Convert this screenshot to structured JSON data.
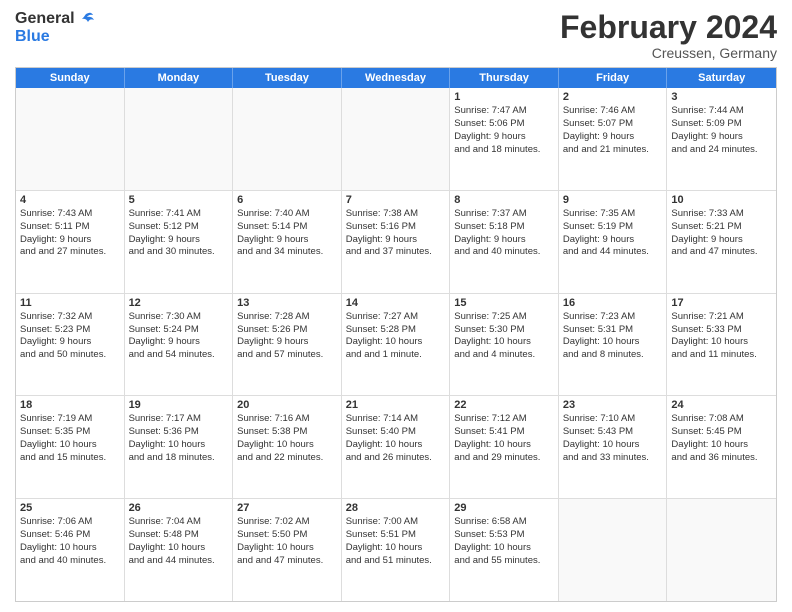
{
  "header": {
    "logo_line1": "General",
    "logo_line2": "Blue",
    "main_title": "February 2024",
    "subtitle": "Creussen, Germany"
  },
  "days_of_week": [
    "Sunday",
    "Monday",
    "Tuesday",
    "Wednesday",
    "Thursday",
    "Friday",
    "Saturday"
  ],
  "weeks": [
    [
      {
        "day": "",
        "empty": true
      },
      {
        "day": "",
        "empty": true
      },
      {
        "day": "",
        "empty": true
      },
      {
        "day": "",
        "empty": true
      },
      {
        "day": "1",
        "sunrise": "Sunrise: 7:47 AM",
        "sunset": "Sunset: 5:06 PM",
        "daylight": "Daylight: 9 hours and 18 minutes."
      },
      {
        "day": "2",
        "sunrise": "Sunrise: 7:46 AM",
        "sunset": "Sunset: 5:07 PM",
        "daylight": "Daylight: 9 hours and 21 minutes."
      },
      {
        "day": "3",
        "sunrise": "Sunrise: 7:44 AM",
        "sunset": "Sunset: 5:09 PM",
        "daylight": "Daylight: 9 hours and 24 minutes."
      }
    ],
    [
      {
        "day": "4",
        "sunrise": "Sunrise: 7:43 AM",
        "sunset": "Sunset: 5:11 PM",
        "daylight": "Daylight: 9 hours and 27 minutes."
      },
      {
        "day": "5",
        "sunrise": "Sunrise: 7:41 AM",
        "sunset": "Sunset: 5:12 PM",
        "daylight": "Daylight: 9 hours and 30 minutes."
      },
      {
        "day": "6",
        "sunrise": "Sunrise: 7:40 AM",
        "sunset": "Sunset: 5:14 PM",
        "daylight": "Daylight: 9 hours and 34 minutes."
      },
      {
        "day": "7",
        "sunrise": "Sunrise: 7:38 AM",
        "sunset": "Sunset: 5:16 PM",
        "daylight": "Daylight: 9 hours and 37 minutes."
      },
      {
        "day": "8",
        "sunrise": "Sunrise: 7:37 AM",
        "sunset": "Sunset: 5:18 PM",
        "daylight": "Daylight: 9 hours and 40 minutes."
      },
      {
        "day": "9",
        "sunrise": "Sunrise: 7:35 AM",
        "sunset": "Sunset: 5:19 PM",
        "daylight": "Daylight: 9 hours and 44 minutes."
      },
      {
        "day": "10",
        "sunrise": "Sunrise: 7:33 AM",
        "sunset": "Sunset: 5:21 PM",
        "daylight": "Daylight: 9 hours and 47 minutes."
      }
    ],
    [
      {
        "day": "11",
        "sunrise": "Sunrise: 7:32 AM",
        "sunset": "Sunset: 5:23 PM",
        "daylight": "Daylight: 9 hours and 50 minutes."
      },
      {
        "day": "12",
        "sunrise": "Sunrise: 7:30 AM",
        "sunset": "Sunset: 5:24 PM",
        "daylight": "Daylight: 9 hours and 54 minutes."
      },
      {
        "day": "13",
        "sunrise": "Sunrise: 7:28 AM",
        "sunset": "Sunset: 5:26 PM",
        "daylight": "Daylight: 9 hours and 57 minutes."
      },
      {
        "day": "14",
        "sunrise": "Sunrise: 7:27 AM",
        "sunset": "Sunset: 5:28 PM",
        "daylight": "Daylight: 10 hours and 1 minute."
      },
      {
        "day": "15",
        "sunrise": "Sunrise: 7:25 AM",
        "sunset": "Sunset: 5:30 PM",
        "daylight": "Daylight: 10 hours and 4 minutes."
      },
      {
        "day": "16",
        "sunrise": "Sunrise: 7:23 AM",
        "sunset": "Sunset: 5:31 PM",
        "daylight": "Daylight: 10 hours and 8 minutes."
      },
      {
        "day": "17",
        "sunrise": "Sunrise: 7:21 AM",
        "sunset": "Sunset: 5:33 PM",
        "daylight": "Daylight: 10 hours and 11 minutes."
      }
    ],
    [
      {
        "day": "18",
        "sunrise": "Sunrise: 7:19 AM",
        "sunset": "Sunset: 5:35 PM",
        "daylight": "Daylight: 10 hours and 15 minutes."
      },
      {
        "day": "19",
        "sunrise": "Sunrise: 7:17 AM",
        "sunset": "Sunset: 5:36 PM",
        "daylight": "Daylight: 10 hours and 18 minutes."
      },
      {
        "day": "20",
        "sunrise": "Sunrise: 7:16 AM",
        "sunset": "Sunset: 5:38 PM",
        "daylight": "Daylight: 10 hours and 22 minutes."
      },
      {
        "day": "21",
        "sunrise": "Sunrise: 7:14 AM",
        "sunset": "Sunset: 5:40 PM",
        "daylight": "Daylight: 10 hours and 26 minutes."
      },
      {
        "day": "22",
        "sunrise": "Sunrise: 7:12 AM",
        "sunset": "Sunset: 5:41 PM",
        "daylight": "Daylight: 10 hours and 29 minutes."
      },
      {
        "day": "23",
        "sunrise": "Sunrise: 7:10 AM",
        "sunset": "Sunset: 5:43 PM",
        "daylight": "Daylight: 10 hours and 33 minutes."
      },
      {
        "day": "24",
        "sunrise": "Sunrise: 7:08 AM",
        "sunset": "Sunset: 5:45 PM",
        "daylight": "Daylight: 10 hours and 36 minutes."
      }
    ],
    [
      {
        "day": "25",
        "sunrise": "Sunrise: 7:06 AM",
        "sunset": "Sunset: 5:46 PM",
        "daylight": "Daylight: 10 hours and 40 minutes."
      },
      {
        "day": "26",
        "sunrise": "Sunrise: 7:04 AM",
        "sunset": "Sunset: 5:48 PM",
        "daylight": "Daylight: 10 hours and 44 minutes."
      },
      {
        "day": "27",
        "sunrise": "Sunrise: 7:02 AM",
        "sunset": "Sunset: 5:50 PM",
        "daylight": "Daylight: 10 hours and 47 minutes."
      },
      {
        "day": "28",
        "sunrise": "Sunrise: 7:00 AM",
        "sunset": "Sunset: 5:51 PM",
        "daylight": "Daylight: 10 hours and 51 minutes."
      },
      {
        "day": "29",
        "sunrise": "Sunrise: 6:58 AM",
        "sunset": "Sunset: 5:53 PM",
        "daylight": "Daylight: 10 hours and 55 minutes."
      },
      {
        "day": "",
        "empty": true
      },
      {
        "day": "",
        "empty": true
      }
    ]
  ]
}
